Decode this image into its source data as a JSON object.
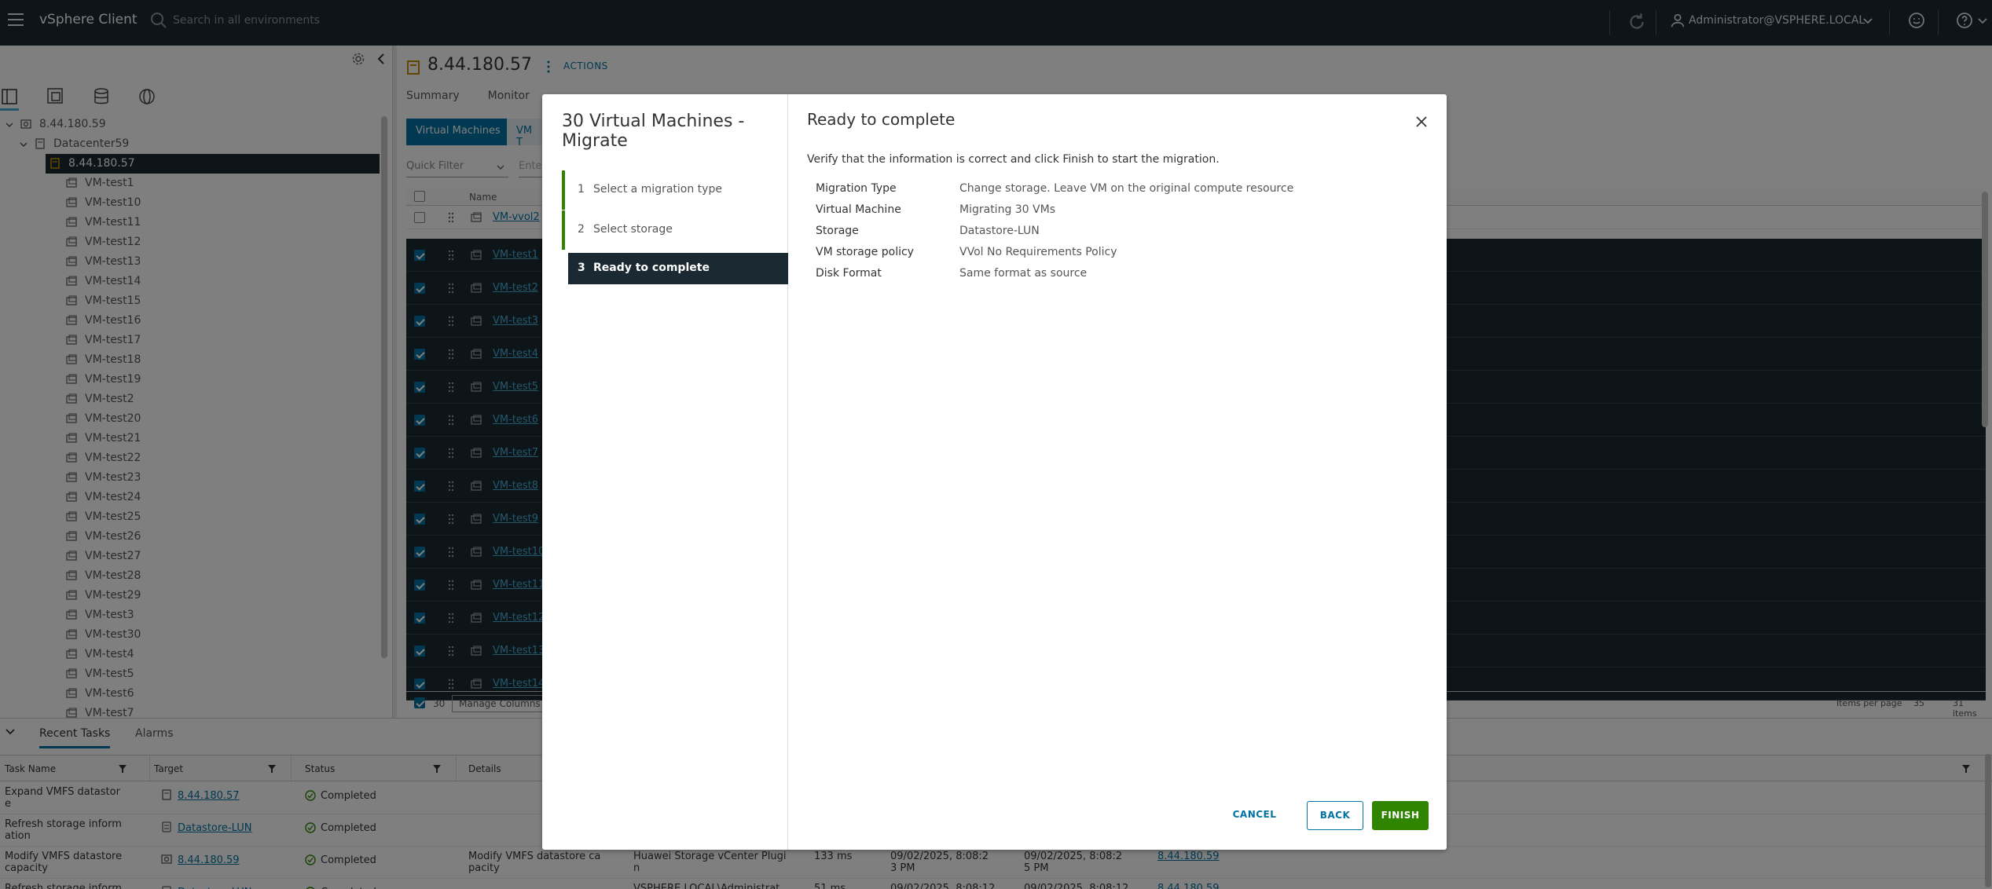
{
  "header": {
    "app_title": "vSphere Client",
    "search_placeholder": "Search in all environments",
    "user": "Administrator@VSPHERE.LOCAL"
  },
  "navigator": {
    "tree": [
      {
        "label": "8.44.180.59",
        "icon": "vcenter-icon",
        "indent": 0,
        "expanded": true
      },
      {
        "label": "Datacenter59",
        "icon": "datacenter-icon",
        "indent": 1,
        "expanded": true
      },
      {
        "label": "8.44.180.57",
        "icon": "host-icon",
        "indent": 2,
        "expanded": true,
        "selected": true
      },
      {
        "label": "VM-test1",
        "icon": "vm-icon",
        "indent": 3
      },
      {
        "label": "VM-test10",
        "icon": "vm-icon",
        "indent": 3
      },
      {
        "label": "VM-test11",
        "icon": "vm-icon",
        "indent": 3
      },
      {
        "label": "VM-test12",
        "icon": "vm-icon",
        "indent": 3
      },
      {
        "label": "VM-test13",
        "icon": "vm-icon",
        "indent": 3
      },
      {
        "label": "VM-test14",
        "icon": "vm-icon",
        "indent": 3
      },
      {
        "label": "VM-test15",
        "icon": "vm-icon",
        "indent": 3
      },
      {
        "label": "VM-test16",
        "icon": "vm-icon",
        "indent": 3
      },
      {
        "label": "VM-test17",
        "icon": "vm-icon",
        "indent": 3
      },
      {
        "label": "VM-test18",
        "icon": "vm-icon",
        "indent": 3
      },
      {
        "label": "VM-test19",
        "icon": "vm-icon",
        "indent": 3
      },
      {
        "label": "VM-test2",
        "icon": "vm-icon",
        "indent": 3
      },
      {
        "label": "VM-test20",
        "icon": "vm-icon",
        "indent": 3
      },
      {
        "label": "VM-test21",
        "icon": "vm-icon",
        "indent": 3
      },
      {
        "label": "VM-test22",
        "icon": "vm-icon",
        "indent": 3
      },
      {
        "label": "VM-test23",
        "icon": "vm-icon",
        "indent": 3
      },
      {
        "label": "VM-test24",
        "icon": "vm-icon",
        "indent": 3
      },
      {
        "label": "VM-test25",
        "icon": "vm-icon",
        "indent": 3
      },
      {
        "label": "VM-test26",
        "icon": "vm-icon",
        "indent": 3
      },
      {
        "label": "VM-test27",
        "icon": "vm-icon",
        "indent": 3
      },
      {
        "label": "VM-test28",
        "icon": "vm-icon",
        "indent": 3
      },
      {
        "label": "VM-test29",
        "icon": "vm-icon",
        "indent": 3
      },
      {
        "label": "VM-test3",
        "icon": "vm-icon",
        "indent": 3
      },
      {
        "label": "VM-test30",
        "icon": "vm-icon",
        "indent": 3
      },
      {
        "label": "VM-test4",
        "icon": "vm-icon",
        "indent": 3
      },
      {
        "label": "VM-test5",
        "icon": "vm-icon",
        "indent": 3
      },
      {
        "label": "VM-test6",
        "icon": "vm-icon",
        "indent": 3
      },
      {
        "label": "VM-test7",
        "icon": "vm-icon",
        "indent": 3
      }
    ]
  },
  "main": {
    "object_title": "8.44.180.57",
    "actions_label": "ACTIONS",
    "tabs": [
      "Summary",
      "Monitor"
    ],
    "subtabs": [
      "Virtual Machines",
      "VM T"
    ],
    "quick_filter": "Quick Filter",
    "filter_placeholder": "Ente",
    "column_name": "Name",
    "rows": [
      {
        "name": "VM-vvol2",
        "checked": false
      },
      {
        "name": "VM-test1",
        "checked": true
      },
      {
        "name": "VM-test2",
        "checked": true
      },
      {
        "name": "VM-test3",
        "checked": true
      },
      {
        "name": "VM-test4",
        "checked": true
      },
      {
        "name": "VM-test5",
        "checked": true
      },
      {
        "name": "VM-test6",
        "checked": true
      },
      {
        "name": "VM-test7",
        "checked": true
      },
      {
        "name": "VM-test8",
        "checked": true
      },
      {
        "name": "VM-test9",
        "checked": true
      },
      {
        "name": "VM-test10",
        "checked": true
      },
      {
        "name": "VM-test11",
        "checked": true
      },
      {
        "name": "VM-test12",
        "checked": true
      },
      {
        "name": "VM-test13",
        "checked": true
      },
      {
        "name": "VM-test14",
        "checked": true
      }
    ],
    "footer": {
      "selected_count": "30",
      "manage_columns": "Manage Columns",
      "items_per_page_label": "Items per page",
      "items_per_page": "35",
      "total_items": "31 items"
    }
  },
  "tasks_panel": {
    "tabs": [
      "Recent Tasks",
      "Alarms"
    ],
    "columns": [
      "Task Name",
      "Target",
      "Status",
      "Details"
    ],
    "rows": [
      {
        "task": "Expand VMFS datastor\ne",
        "target": "8.44.180.57",
        "target_icon": "host-icon",
        "status": "Completed",
        "details": "",
        "initiator": "",
        "queued": "",
        "start": "",
        "completion": "",
        "server": ""
      },
      {
        "task": "Refresh storage inform\nation",
        "target": "Datastore-LUN",
        "target_icon": "datastore-icon",
        "status": "Completed",
        "details": "",
        "initiator": "",
        "queued": "",
        "start": "",
        "completion": "",
        "server": ""
      },
      {
        "task": "Modify VMFS datastore\ncapacity",
        "target": "8.44.180.59",
        "target_icon": "vcenter-icon",
        "status": "Completed",
        "details": "Modify VMFS datastore ca\npacity",
        "initiator": "Huawei Storage vCenter Plugi\nn",
        "queued": "133 ms",
        "start": "09/02/2025, 8:08:2\n3 PM",
        "completion": "09/02/2025, 8:08:2\n5 PM",
        "server": "8.44.180.59"
      },
      {
        "task": "Refresh storage inform",
        "target": "Datastore-LUN",
        "target_icon": "datastore-icon",
        "status": "Completed",
        "details": "",
        "initiator": "VSPHERE.LOCAL\\Administrat",
        "queued": "51 ms",
        "start": "09/02/2025, 8:08:12",
        "completion": "09/02/2025, 8:08:12",
        "server": "8.44.180.59"
      }
    ]
  },
  "wizard": {
    "title": "30 Virtual Machines - Migrate",
    "steps": [
      {
        "num": "1",
        "label": "Select a migration type",
        "state": "done"
      },
      {
        "num": "2",
        "label": "Select storage",
        "state": "done"
      },
      {
        "num": "3",
        "label": "Ready to complete",
        "state": "current"
      }
    ],
    "page_title": "Ready to complete",
    "intro": "Verify that the information is correct and click Finish to start the migration.",
    "summary": [
      {
        "key": "Migration Type",
        "value": "Change storage. Leave VM on the original compute resource"
      },
      {
        "key": "Virtual Machine",
        "value": "Migrating 30 VMs"
      },
      {
        "key": "Storage",
        "value": "Datastore-LUN"
      },
      {
        "key": "VM storage policy",
        "value": "VVol No Requirements Policy"
      },
      {
        "key": "Disk Format",
        "value": "Same format as source"
      }
    ],
    "buttons": {
      "cancel": "CANCEL",
      "back": "BACK",
      "finish": "FINISH"
    }
  },
  "colors": {
    "header_bg": "#1b2a32",
    "accent": "#0072a3",
    "finish_green": "#2f8400",
    "selected_row": "#1b2a32"
  }
}
